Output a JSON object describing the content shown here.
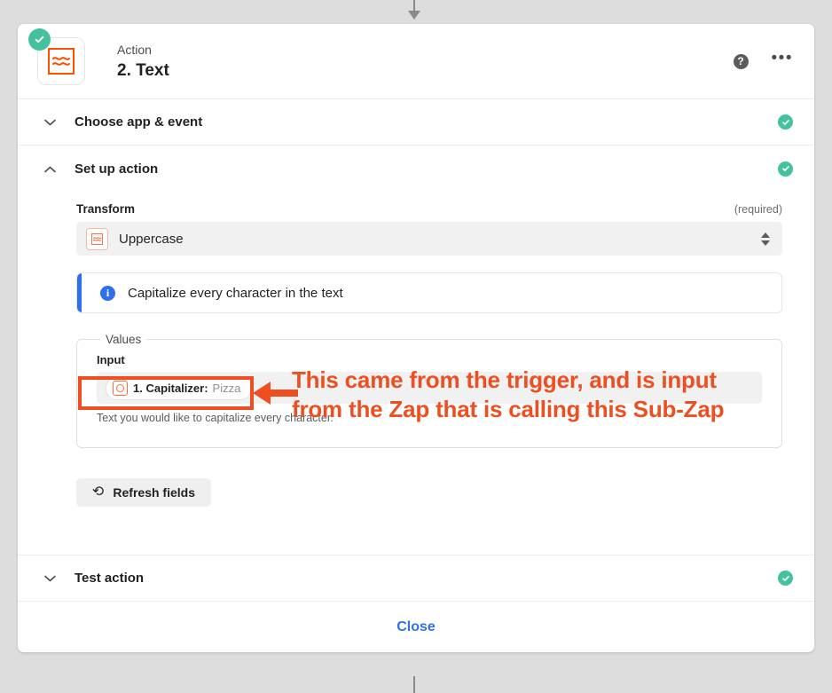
{
  "connectors": {
    "top_arrow_icon": "arrow-down-icon",
    "bottom_line": "connector-line"
  },
  "header": {
    "app_icon": "text-app-icon",
    "status_icon": "check-circle-icon",
    "kicker": "Action",
    "title": "2. Text",
    "help_icon": "?",
    "more_icon": "•••"
  },
  "sections": [
    {
      "id": "choose-app-event",
      "label": "Choose app & event",
      "chevron": "⌄",
      "expanded": false,
      "status": "complete"
    },
    {
      "id": "set-up-action",
      "label": "Set up action",
      "chevron": "⌃",
      "expanded": true,
      "status": "complete"
    },
    {
      "id": "test-action",
      "label": "Test action",
      "chevron": "⌄",
      "expanded": false,
      "status": "complete"
    }
  ],
  "setup": {
    "transform": {
      "label": "Transform",
      "required_note": "(required)",
      "selected_value": "Uppercase",
      "option_icon": "uppercase-transform-icon",
      "stepper_icon": "stepper-arrows-icon"
    },
    "callout": {
      "icon": "info-icon",
      "icon_glyph": "i",
      "text": "Capitalize every character in the text",
      "accent_color": "#2f6fed"
    },
    "values": {
      "legend": "Values",
      "input_label": "Input",
      "token_icon": "zap-field-token-icon",
      "token_label": "1. Capitalizer:",
      "token_value": "Pizza",
      "help_text": "Text you would like to capitalize every character."
    },
    "refresh_button": {
      "icon": "refresh-icon",
      "icon_glyph": "⟳",
      "label": "Refresh fields"
    }
  },
  "footer": {
    "close_label": "Close"
  },
  "annotation": {
    "color": "#ef4f20",
    "arrow_icon": "arrow-left-icon",
    "line1": "This came from the trigger, and is input",
    "line2": "from the Zap that is calling this Sub-Zap"
  }
}
